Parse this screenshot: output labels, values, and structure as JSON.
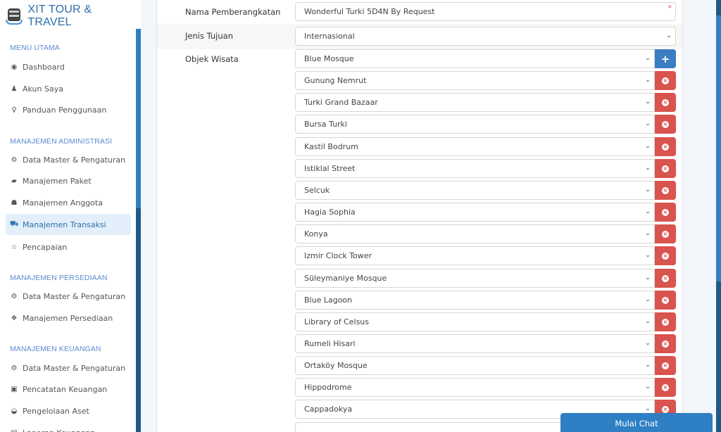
{
  "brand": {
    "name": "XIT TOUR & TRAVEL",
    "logo_icon": "database-icon"
  },
  "sidebar": {
    "sections": [
      {
        "title": "MENU UTAMA",
        "items": [
          {
            "label": "Dashboard",
            "icon": "globe-icon",
            "glyph": "◉"
          },
          {
            "label": "Akun Saya",
            "icon": "user-icon",
            "glyph": "♟"
          },
          {
            "label": "Panduan Penggunaan",
            "icon": "lightbulb-icon",
            "glyph": "♀"
          }
        ]
      },
      {
        "title": "MANAJEMEN ADMINISTRASI",
        "items": [
          {
            "label": "Data Master & Pengaturan",
            "icon": "cogs-icon",
            "glyph": "⚙"
          },
          {
            "label": "Manajemen Paket",
            "icon": "book-icon",
            "glyph": "▰"
          },
          {
            "label": "Manajemen Anggota",
            "icon": "users-icon",
            "glyph": "☗"
          },
          {
            "label": "Manajemen Transaksi",
            "icon": "cart-icon",
            "glyph": "⛟",
            "active": true
          },
          {
            "label": "Pencapaian",
            "icon": "star-icon",
            "glyph": "☆"
          }
        ]
      },
      {
        "title": "MANAJEMEN PERSEDIAAN",
        "items": [
          {
            "label": "Data Master & Pengaturan",
            "icon": "cogs-icon",
            "glyph": "⚙"
          },
          {
            "label": "Manajemen Persediaan",
            "icon": "cubes-icon",
            "glyph": "❖"
          }
        ]
      },
      {
        "title": "MANAJEMEN KEUANGAN",
        "items": [
          {
            "label": "Data Master & Pengaturan",
            "icon": "cogs-icon",
            "glyph": "⚙"
          },
          {
            "label": "Pencatatan Keuangan",
            "icon": "money-icon",
            "glyph": "▣"
          },
          {
            "label": "Pengelolaan Aset",
            "icon": "inbox-icon",
            "glyph": "◒"
          },
          {
            "label": "Laporan Keuangan",
            "icon": "report-icon",
            "glyph": "▤"
          }
        ]
      }
    ]
  },
  "form": {
    "nama_label": "Nama Pemberangkatan",
    "nama_value": "Wonderful Turki 5D4N By Request",
    "required_mark": "*",
    "jenis_label": "Jenis Tujuan",
    "jenis_value": "Internasional",
    "objek_label": "Objek Wisata",
    "add_glyph": "+",
    "remove_glyph": "×",
    "chevron_glyph": "⌄",
    "objek_items": [
      "Blue Mosque",
      "Gunung Nemrut",
      "Turki Grand Bazaar",
      "Bursa Turki",
      "Kastil Bodrum",
      "Istiklal Street",
      "Selcuk",
      "Hagia Sophia",
      "Konya",
      "Izmir Clock Tower",
      "Süleymaniye Mosque",
      "Blue Lagoon",
      "Library of Celsus",
      "Rumeli Hisari",
      "Ortaköy Mosque",
      "Hippodrome",
      "Cappadokya",
      ""
    ]
  },
  "chat": {
    "label": "Mulai Chat"
  }
}
